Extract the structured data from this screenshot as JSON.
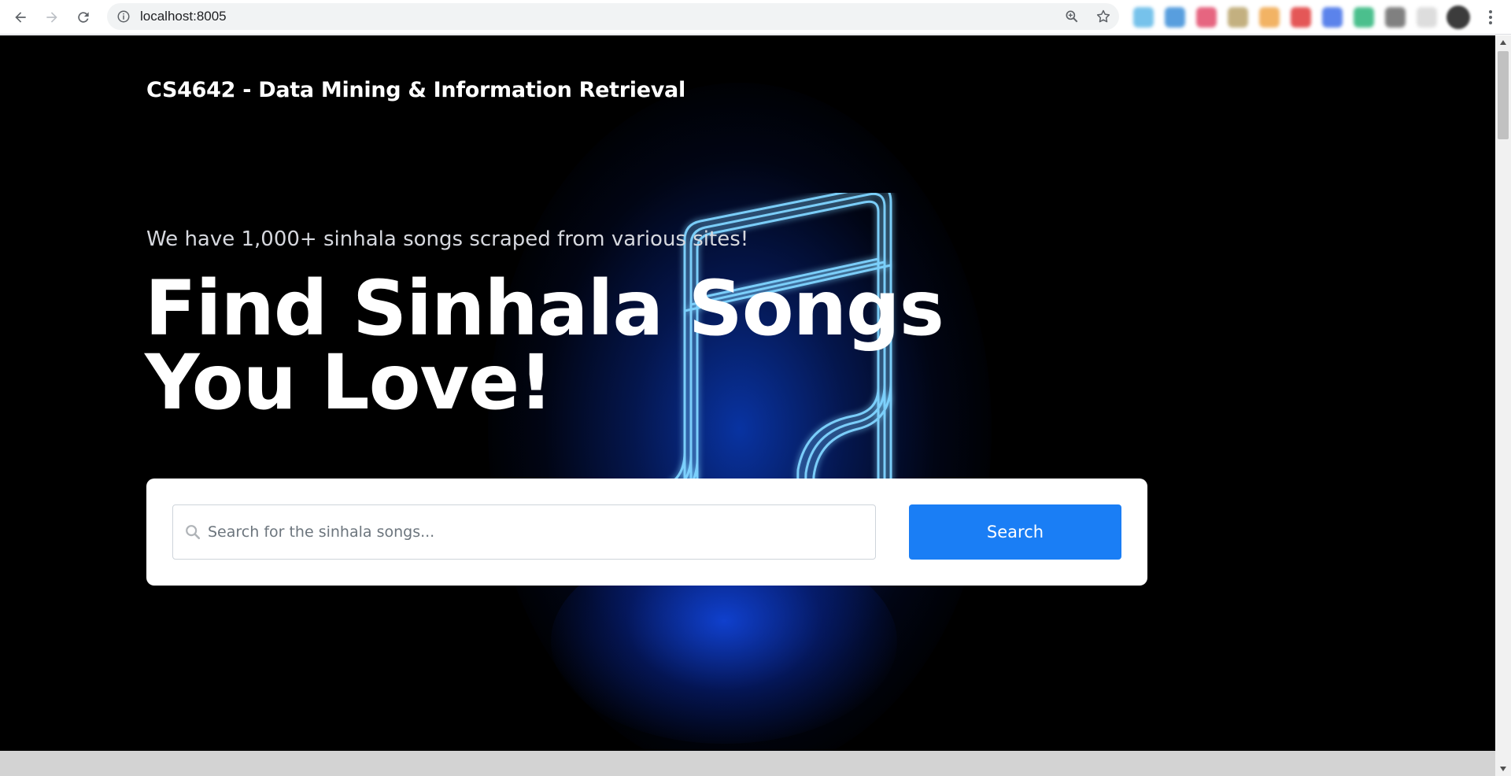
{
  "browser": {
    "url": "localhost:8005",
    "nav_icons": [
      "back-arrow-icon",
      "forward-arrow-icon",
      "reload-icon"
    ],
    "omnibox_icons": [
      "info-icon",
      "zoom-icon",
      "bookmark-star-icon"
    ],
    "extension_colors": [
      "#5fb8e8",
      "#3b8ed9",
      "#e24b6b",
      "#b9a36a",
      "#f0a64a",
      "#e03a3a",
      "#3f6ee8",
      "#2cb57a",
      "#6b6b6b",
      "#d8d8d8"
    ]
  },
  "header": {
    "course_title": "CS4642 - Data Mining & Information Retrieval"
  },
  "hero": {
    "tagline": "We have 1,000+ sinhala songs scraped from various sites!",
    "title": "Find Sinhala Songs You Love!",
    "background_icon": "music-note-icon"
  },
  "search": {
    "placeholder": "Search for the sinhala songs...",
    "value": "",
    "button_label": "Search",
    "accent_color": "#1a7ef5"
  }
}
